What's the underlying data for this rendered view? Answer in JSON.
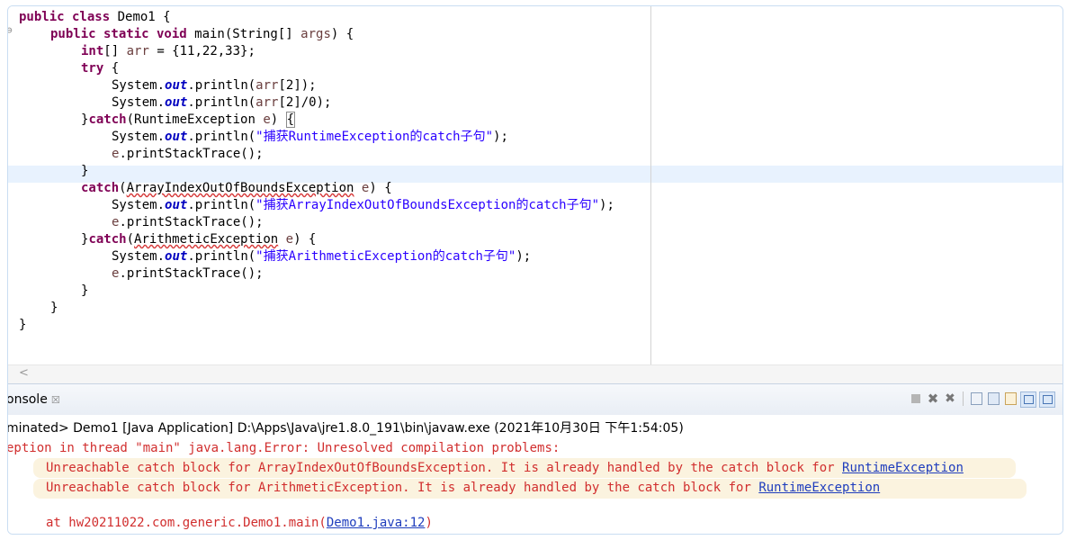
{
  "editor": {
    "lines": [
      {
        "kw": "public class",
        "rest": " Demo1 {"
      },
      {
        "kw": "public static void",
        "rest": " main(String[] ",
        "var": "args",
        "tail": ") {"
      },
      {
        "kw": "int",
        "rest": "[] ",
        "var": "arr",
        "tail": " = {11,22,33};"
      },
      {
        "kw": "try",
        "rest": " {"
      },
      {
        "pre": "System.",
        "fld": "out",
        "post": ".println(",
        "var": "arr",
        "tail": "[2]);"
      },
      {
        "pre": "System.",
        "fld": "out",
        "post": ".println(",
        "var": "arr",
        "tail": "[2]/0);"
      },
      {
        "pre": "}",
        "kw": "catch",
        "post": "(RuntimeException ",
        "var": "e",
        "tail": ") ",
        "bracket": "{"
      },
      {
        "pre": "System.",
        "fld": "out",
        "post": ".println(",
        "str": "\"捕获RuntimeException的catch子句\"",
        "tail": ");"
      },
      {
        "var": "e",
        "tail": ".printStackTrace();"
      },
      {
        "pre": "}"
      },
      {
        "kw": "catch",
        "post": "(",
        "ul": "ArrayIndexOutOfBoundsException",
        "sp": " ",
        "var": "e",
        "tail": ") {"
      },
      {
        "pre": "System.",
        "fld": "out",
        "post": ".println(",
        "str": "\"捕获ArrayIndexOutOfBoundsException的catch子句\"",
        "tail": ");"
      },
      {
        "var": "e",
        "tail": ".printStackTrace();"
      },
      {
        "pre": "}",
        "kw": "catch",
        "post": "(",
        "ul": "ArithmeticException",
        "sp": " ",
        "var": "e",
        "tail": ") {"
      },
      {
        "pre": "System.",
        "fld": "out",
        "post": ".println(",
        "str": "\"捕获ArithmeticException的catch子句\"",
        "tail": ");"
      },
      {
        "var": "e",
        "tail": ".printStackTrace();"
      },
      {
        "pre": "}"
      },
      {
        "pre": "}"
      },
      {
        "pre": "}"
      }
    ]
  },
  "console": {
    "tab_label": "onsole",
    "close_glyph": "☒",
    "terminated": "minated> Demo1 [Java Application] D:\\Apps\\Java\\jre1.8.0_191\\bin\\javaw.exe (2021年10月30日 下午1:54:05)",
    "error_head": "eption in thread \"main\" java.lang.Error: Unresolved compilation problems:",
    "problem1_text": "Unreachable catch block for ArrayIndexOutOfBoundsException. It is already handled by the catch block for ",
    "problem1_link": "RuntimeException",
    "problem2_text": "Unreachable catch block for ArithmeticException. It is already handled by the catch block for ",
    "problem2_link": "RuntimeException",
    "stack_text": "at hw20211022.com.generic.Demo1.main(",
    "stack_link": "Demo1.java:12",
    "stack_tail": ")",
    "icons": [
      "terminate-icon",
      "remove-launch-icon",
      "remove-all-icon",
      "scroll-lock-icon",
      "pin-icon",
      "word-wrap-icon",
      "open-console-icon",
      "display-console-icon"
    ]
  },
  "colors": {
    "keyword": "#7f0055",
    "field": "#0000c0",
    "string": "#2a00ff",
    "error": "#d12e2e",
    "link": "#1f3dbd",
    "current_line": "#e8f2fe"
  }
}
